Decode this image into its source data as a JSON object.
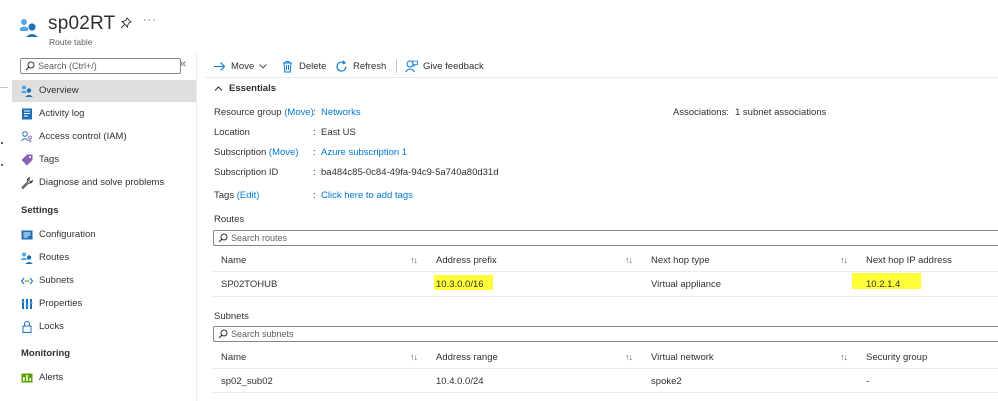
{
  "header": {
    "title": "sp02RT",
    "subtitle": "Route table",
    "more": "···"
  },
  "sidebar": {
    "search_placeholder": "Search (Ctrl+/)",
    "collapse": "«",
    "items": [
      {
        "label": "Overview",
        "icon": "route-table-icon"
      },
      {
        "label": "Activity log",
        "icon": "activity-log-icon"
      },
      {
        "label": "Access control (IAM)",
        "icon": "iam-icon"
      },
      {
        "label": "Tags",
        "icon": "tag-icon"
      },
      {
        "label": "Diagnose and solve problems",
        "icon": "wrench-icon"
      }
    ],
    "sections": [
      {
        "title": "Settings",
        "items": [
          {
            "label": "Configuration",
            "icon": "configuration-icon"
          },
          {
            "label": "Routes",
            "icon": "routes-icon"
          },
          {
            "label": "Subnets",
            "icon": "subnets-icon"
          },
          {
            "label": "Properties",
            "icon": "properties-icon"
          },
          {
            "label": "Locks",
            "icon": "lock-icon"
          }
        ]
      },
      {
        "title": "Monitoring",
        "items": [
          {
            "label": "Alerts",
            "icon": "alerts-icon"
          }
        ]
      }
    ]
  },
  "toolbar": {
    "move": "Move",
    "delete": "Delete",
    "refresh": "Refresh",
    "feedback": "Give feedback"
  },
  "essentials": {
    "title": "Essentials",
    "resource_group": {
      "label": "Resource group",
      "action": "(Move)",
      "value": "Networks"
    },
    "location": {
      "label": "Location",
      "value": "East US"
    },
    "subscription": {
      "label": "Subscription",
      "action": "(Move)",
      "value": "Azure subscription 1"
    },
    "subscription_id": {
      "label": "Subscription ID",
      "value": "ba484c85-0c84-49fa-94c9-5a740a80d31d"
    },
    "tags": {
      "label": "Tags",
      "action": "(Edit)",
      "value": "Click here to add tags"
    },
    "associations": {
      "label": "Associations",
      "value": "1 subnet associations"
    },
    "colon": ":"
  },
  "routes": {
    "title": "Routes",
    "search_placeholder": "Search routes",
    "sort_glyph": "↑↓",
    "columns": [
      "Name",
      "Address prefix",
      "Next hop type",
      "Next hop IP address"
    ],
    "rows": [
      {
        "name": "SP02TOHUB",
        "prefix": "10.3.0.0/16",
        "hop_type": "Virtual appliance",
        "hop_ip": "10.2.1.4"
      }
    ]
  },
  "subnets": {
    "title": "Subnets",
    "search_placeholder": "Search subnets",
    "sort_glyph": "↑↓",
    "columns": [
      "Name",
      "Address range",
      "Virtual network",
      "Security group"
    ],
    "rows": [
      {
        "name": "sp02_sub02",
        "range": "10.4.0.0/24",
        "vnet": "spoke2",
        "nsg": "-"
      }
    ]
  },
  "colors": {
    "link": "#0078d4",
    "highlight": "#ffff3a",
    "active_nav": "#e1dfdd"
  }
}
